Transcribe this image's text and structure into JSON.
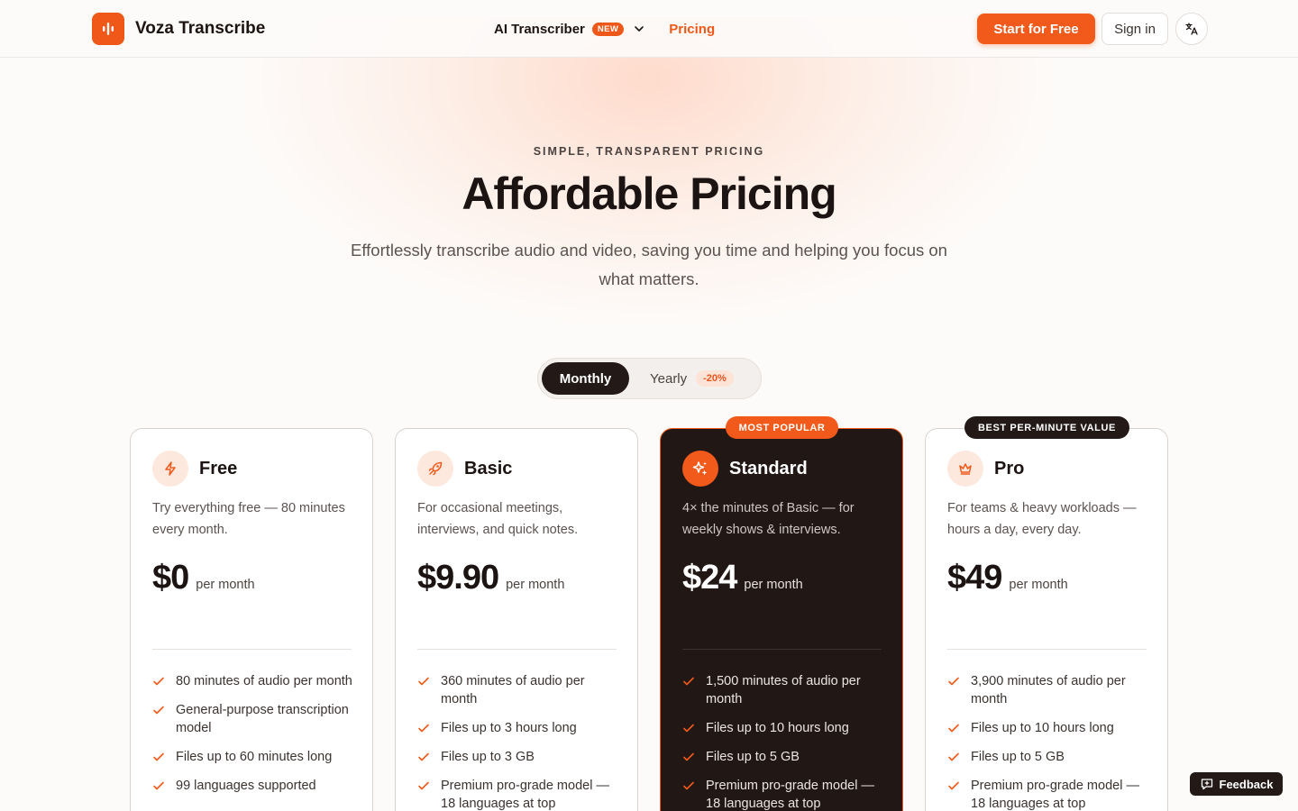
{
  "header": {
    "brand_name": "Voza Transcribe",
    "nav_transcriber": "AI Transcriber",
    "new_badge": "NEW",
    "nav_pricing": "Pricing",
    "start_button": "Start for Free",
    "signin_button": "Sign in"
  },
  "hero": {
    "eyebrow": "SIMPLE, TRANSPARENT PRICING",
    "title": "Affordable Pricing",
    "subtitle": "Effortlessly transcribe audio and video, saving you time and helping you focus on what matters."
  },
  "billing_toggle": {
    "monthly": "Monthly",
    "yearly": "Yearly",
    "discount": "-20%"
  },
  "badges": {
    "popular": "MOST POPULAR",
    "value": "BEST PER-MINUTE VALUE"
  },
  "plans": [
    {
      "name": "Free",
      "icon": "lightning-icon",
      "description": "Try everything free — 80 minutes every month.",
      "price": "$0",
      "period": "per month",
      "features": [
        "80 minutes of audio per month",
        "General-purpose transcription model",
        "Files up to 60 minutes long",
        "99 languages supported"
      ]
    },
    {
      "name": "Basic",
      "icon": "rocket-icon",
      "description": "For occasional meetings, interviews, and quick notes.",
      "price": "$9.90",
      "period": "per month",
      "features": [
        "360 minutes of audio per month",
        "Files up to 3 hours long",
        "Files up to 3 GB",
        "Premium pro-grade model — 18 languages at top"
      ]
    },
    {
      "name": "Standard",
      "icon": "sparkles-icon",
      "description": "4× the minutes of Basic — for weekly shows & interviews.",
      "price": "$24",
      "period": "per month",
      "features": [
        "1,500 minutes of audio per month",
        "Files up to 10 hours long",
        "Files up to 5 GB",
        "Premium pro-grade model — 18 languages at top"
      ]
    },
    {
      "name": "Pro",
      "icon": "crown-icon",
      "description": "For teams & heavy workloads — hours a day, every day.",
      "price": "$49",
      "period": "per month",
      "features": [
        "3,900 minutes of audio per month",
        "Files up to 10 hours long",
        "Files up to 5 GB",
        "Premium pro-grade model — 18 languages at top"
      ]
    }
  ],
  "feedback_button": "Feedback",
  "colors": {
    "accent": "#f25a1b",
    "dark": "#211816",
    "background": "#fdfbf9"
  }
}
